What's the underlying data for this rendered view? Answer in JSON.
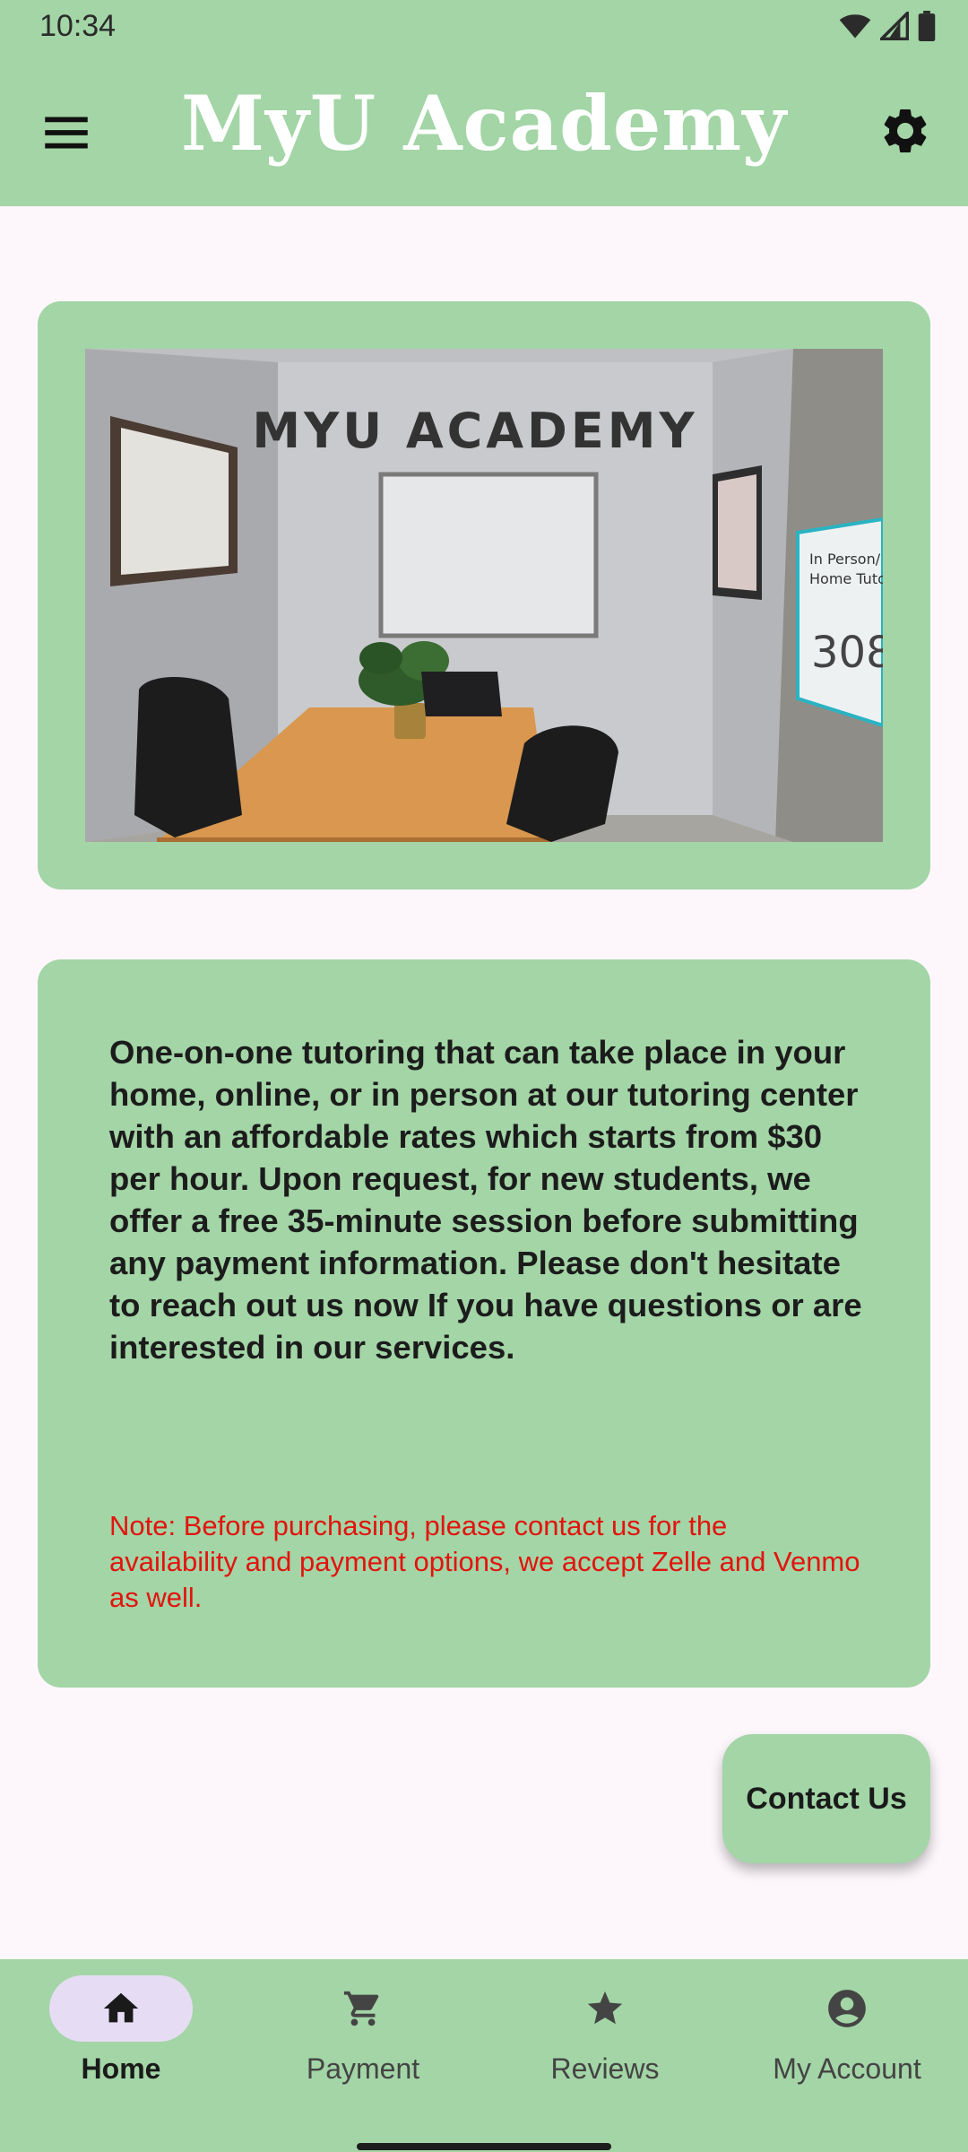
{
  "status_bar": {
    "time": "10:34"
  },
  "app_bar": {
    "title": "MyU Academy"
  },
  "image_card": {
    "wall_text": "MYU ACADEMY",
    "sign_line1": "In Person/",
    "sign_line2": "Home Tutoring",
    "sign_number": "308"
  },
  "info_card": {
    "description": "One-on-one tutoring that can take place in your home, online, or in person at our tutoring center with an affordable rates which starts from $30 per hour.  Upon request, for new students, we offer a free 35-minute session before submitting any payment information. Please don't hesitate to reach out us now If you have questions or are interested in our services.",
    "note": "Note: Before purchasing, please contact us for the availability and payment options, we accept Zelle and Venmo as well."
  },
  "fab": {
    "label": "Contact Us"
  },
  "bottom_nav": {
    "items": [
      {
        "label": "Home",
        "icon": "home-icon",
        "active": true
      },
      {
        "label": "Payment",
        "icon": "cart-icon",
        "active": false
      },
      {
        "label": "Reviews",
        "icon": "star-icon",
        "active": false
      },
      {
        "label": "My Account",
        "icon": "account-icon",
        "active": false
      }
    ]
  },
  "colors": {
    "primary_green": "#a3d5a6",
    "background": "#fdf7fc",
    "note_red": "#e2140f",
    "nav_active_pill": "#e6dcf4"
  }
}
